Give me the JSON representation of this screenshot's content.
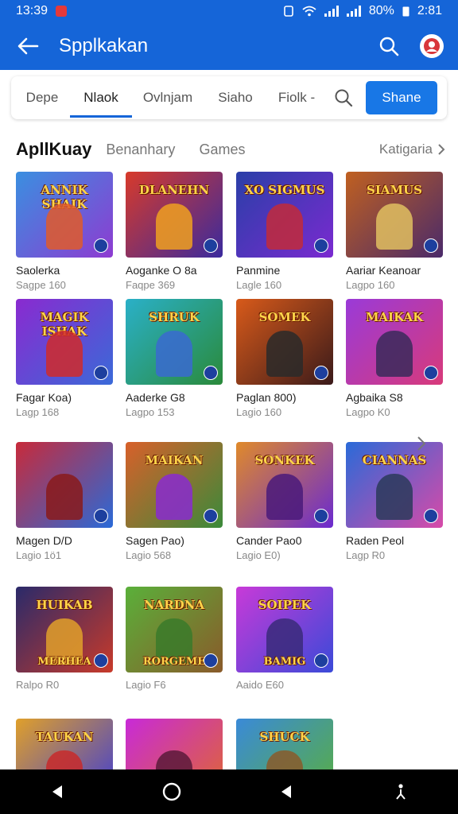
{
  "status": {
    "time": "13:39",
    "battery": "80%",
    "clock_right": "2:81"
  },
  "app_bar": {
    "title": "Spplkakan"
  },
  "tabs": [
    {
      "label": "Depe"
    },
    {
      "label": "Nlaok"
    },
    {
      "label": "Ovlnjam"
    },
    {
      "label": "Siaho"
    },
    {
      "label": "Fiolk -"
    }
  ],
  "share_label": "Shane",
  "section": {
    "title": "ApllKuay",
    "subtitle": "Benanhary",
    "games": "Games",
    "category": "Katigaria"
  },
  "cards": [
    {
      "title": "Saolerka",
      "sub": "Sagpe 160",
      "banner": "ANNIK SHAIK",
      "c1": "#3a8fe0",
      "c2": "#8e3bd1",
      "hero": "#e05a2a"
    },
    {
      "title": "Aoganke O 8a",
      "sub": "Faqpe 369",
      "banner": "DLANEHN",
      "c1": "#d83a2a",
      "c2": "#3a2a9e",
      "hero": "#f0a020"
    },
    {
      "title": "Panmine",
      "sub": "Lagle 160",
      "banner": "XO SIGMUS",
      "c1": "#2a3fa8",
      "c2": "#7a2ad0",
      "hero": "#c22a3a"
    },
    {
      "title": "Aariar Keanoar",
      "sub": "Lagpo 160",
      "banner": "SIAMUS",
      "c1": "#c06020",
      "c2": "#4a2a6a",
      "hero": "#e0c060"
    },
    {
      "title": "Fagar Koa)",
      "sub": "Lagp 168",
      "banner": "MAGIK ISHAK",
      "c1": "#8a2ad0",
      "c2": "#3a6ad8",
      "hero": "#d02a2a"
    },
    {
      "title": "Aaderke G8",
      "sub": "Lagpo 153",
      "banner": "SHRUK",
      "c1": "#2ab0c8",
      "c2": "#2a8a3a",
      "hero": "#3a6ad0"
    },
    {
      "title": "Paglan 800)",
      "sub": "Lagio 160",
      "banner": "SOMEK",
      "c1": "#d85a1a",
      "c2": "#3a1a1a",
      "hero": "#2a2a2a"
    },
    {
      "title": "Agbaika S8",
      "sub": "Lagpo K0",
      "banner": "MAIKAK",
      "c1": "#9a3ad8",
      "c2": "#d83a7a",
      "hero": "#3a2a5a"
    },
    {
      "title": "Magen D/D",
      "sub": "Lagio 1ö1",
      "banner": "",
      "c1": "#c82a3a",
      "c2": "#2a6ad8",
      "hero": "#8a1a1a"
    },
    {
      "title": "Sagen Pao)",
      "sub": "Lagio 568",
      "banner": "MAIKAN",
      "c1": "#d8602a",
      "c2": "#3a8a3a",
      "hero": "#8a2ad0"
    },
    {
      "title": "Cander Pao0",
      "sub": "Lagio E0)",
      "banner": "SONKEK",
      "c1": "#e08a2a",
      "c2": "#6a2ad0",
      "hero": "#4a1a7a"
    },
    {
      "title": "Raden Peol",
      "sub": "Lagp R0",
      "banner": "CIANNAS",
      "c1": "#2a6ad8",
      "c2": "#d84aa8",
      "hero": "#2a3a5a"
    },
    {
      "title": "",
      "sub": "Ralpo R0",
      "banner": "HUIKAB",
      "c1": "#2a2a6a",
      "c2": "#c83a2a",
      "hero": "#e0a02a"
    },
    {
      "title": "",
      "sub": "Lagio F6",
      "banner": "NARDNA",
      "c1": "#5ab03a",
      "c2": "#8a5a2a",
      "hero": "#3a7a2a"
    },
    {
      "title": "",
      "sub": "Aaido E60",
      "banner": "SOIPEK",
      "c1": "#c83ad8",
      "c2": "#3a4ad8",
      "hero": "#3a2a7a"
    },
    {
      "title": "",
      "sub": "",
      "banner": "TAUKAN",
      "c1": "#e0a02a",
      "c2": "#3a3ad8",
      "hero": "#c82a2a"
    },
    {
      "title": "",
      "sub": "",
      "banner": "",
      "c1": "#c82ad8",
      "c2": "#e06a2a",
      "hero": "#5a1a3a"
    },
    {
      "title": "",
      "sub": "",
      "banner": "SHUCK",
      "c1": "#3a8ad8",
      "c2": "#5ab03a",
      "hero": "#8a5a2a"
    }
  ],
  "row4_labels": [
    "MERHEA",
    "RORGEME",
    "BAMIG"
  ],
  "colors": {
    "primary": "#1565d8",
    "share": "#1877e6"
  }
}
